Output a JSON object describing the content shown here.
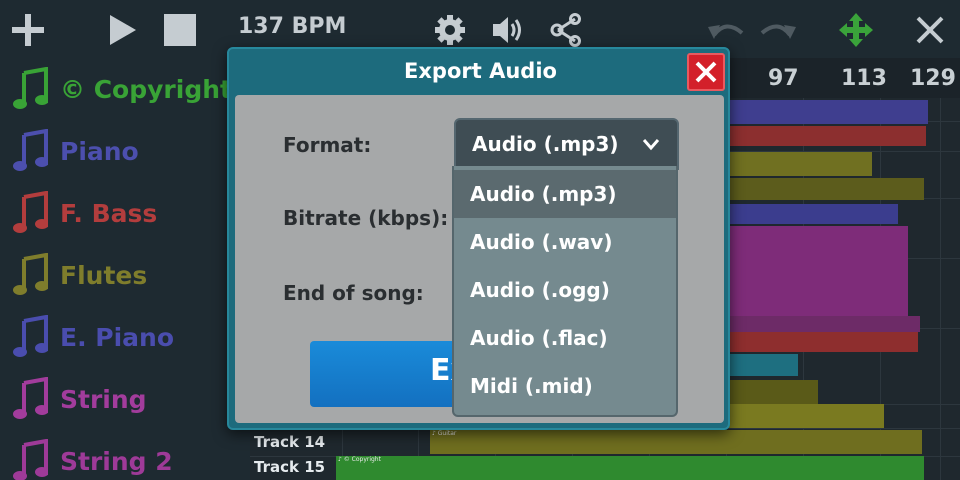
{
  "toolbar": {
    "bpm": "137 BPM",
    "icons": [
      "plus-icon",
      "play-icon",
      "stop-icon",
      "gear-icon",
      "volume-icon",
      "share-icon",
      "undo-icon",
      "redo-icon",
      "move-icon",
      "close-icon"
    ]
  },
  "tracks": [
    {
      "name": "© Copyright",
      "color": "#39a336"
    },
    {
      "name": "Piano",
      "color": "#4c4fae"
    },
    {
      "name": "F. Bass",
      "color": "#b33d3d"
    },
    {
      "name": "Flutes",
      "color": "#7f7d2c"
    },
    {
      "name": "E. Piano",
      "color": "#4a4dae"
    },
    {
      "name": "String",
      "color": "#a23c9c"
    },
    {
      "name": "String 2",
      "color": "#9e3a98"
    }
  ],
  "timeline": {
    "ruler": [
      "97",
      "113",
      "129"
    ],
    "rows": [
      "Track 14",
      "Track 15"
    ]
  },
  "dialog": {
    "title": "Export Audio",
    "format_label": "Format:",
    "bitrate_label": "Bitrate (kbps):",
    "end_label": "End of song:",
    "format_value": "Audio (.mp3)",
    "export_label": "Ex",
    "options": [
      "Audio (.mp3)",
      "Audio (.wav)",
      "Audio (.ogg)",
      "Audio (.flac)",
      "Midi (.mid)"
    ],
    "selected_option": "Audio (.mp3)"
  },
  "colors": {
    "accent": "#1d6b7d",
    "close": "#d3202a",
    "export": "#1a8bd9"
  }
}
